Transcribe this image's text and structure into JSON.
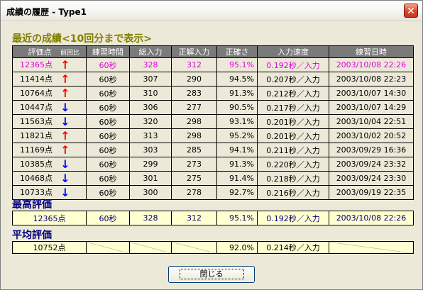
{
  "window": {
    "title": "成績の履歴 ‐ Type1",
    "close_glyph": "✕"
  },
  "recent": {
    "heading": "最近の成績<10回分まで表示>",
    "columns": [
      "評価点",
      "前回比",
      "練習時間",
      "総入力",
      "正解入力",
      "正確さ",
      "入力速度",
      "練習日時"
    ],
    "rows": [
      {
        "score": "12365点",
        "trend": "up",
        "time": "60秒",
        "total": "328",
        "correct": "312",
        "accuracy": "95.1%",
        "speed": "0.192秒／入力",
        "date": "2003/10/08  22:26",
        "highlight": true
      },
      {
        "score": "11414点",
        "trend": "up",
        "time": "60秒",
        "total": "307",
        "correct": "290",
        "accuracy": "94.5%",
        "speed": "0.207秒／入力",
        "date": "2003/10/08  22:23"
      },
      {
        "score": "10764点",
        "trend": "up",
        "time": "60秒",
        "total": "310",
        "correct": "283",
        "accuracy": "91.3%",
        "speed": "0.212秒／入力",
        "date": "2003/10/07  14:30"
      },
      {
        "score": "10447点",
        "trend": "down",
        "time": "60秒",
        "total": "306",
        "correct": "277",
        "accuracy": "90.5%",
        "speed": "0.217秒／入力",
        "date": "2003/10/07  14:29"
      },
      {
        "score": "11563点",
        "trend": "down",
        "time": "60秒",
        "total": "320",
        "correct": "298",
        "accuracy": "93.1%",
        "speed": "0.201秒／入力",
        "date": "2003/10/04  22:51"
      },
      {
        "score": "11821点",
        "trend": "up",
        "time": "60秒",
        "total": "313",
        "correct": "298",
        "accuracy": "95.2%",
        "speed": "0.201秒／入力",
        "date": "2003/10/02  20:52"
      },
      {
        "score": "11169点",
        "trend": "up",
        "time": "60秒",
        "total": "303",
        "correct": "285",
        "accuracy": "94.1%",
        "speed": "0.211秒／入力",
        "date": "2003/09/29  16:36"
      },
      {
        "score": "10385点",
        "trend": "down",
        "time": "60秒",
        "total": "299",
        "correct": "273",
        "accuracy": "91.3%",
        "speed": "0.220秒／入力",
        "date": "2003/09/24  23:32"
      },
      {
        "score": "10468点",
        "trend": "down",
        "time": "60秒",
        "total": "301",
        "correct": "275",
        "accuracy": "91.4%",
        "speed": "0.218秒／入力",
        "date": "2003/09/24  23:30"
      },
      {
        "score": "10733点",
        "trend": "down",
        "time": "60秒",
        "total": "300",
        "correct": "278",
        "accuracy": "92.7%",
        "speed": "0.216秒／入力",
        "date": "2003/09/19  22:35"
      }
    ]
  },
  "best": {
    "heading": "最高評価",
    "score": "12365点",
    "time": "60秒",
    "total": "328",
    "correct": "312",
    "accuracy": "95.1%",
    "speed": "0.192秒／入力",
    "date": "2003/10/08  22:26"
  },
  "average": {
    "heading": "平均評価",
    "score": "10752点",
    "accuracy": "92.0%",
    "speed": "0.214秒／入力"
  },
  "icons": {
    "up": "arrow-up-icon",
    "down": "arrow-down-icon"
  },
  "colors": {
    "up": "#ff0000",
    "down": "#0000ff",
    "highlight": "#e000e0",
    "recent_heading": "#808000",
    "best_heading": "#000080"
  },
  "buttons": {
    "close_label": "閉じる"
  }
}
